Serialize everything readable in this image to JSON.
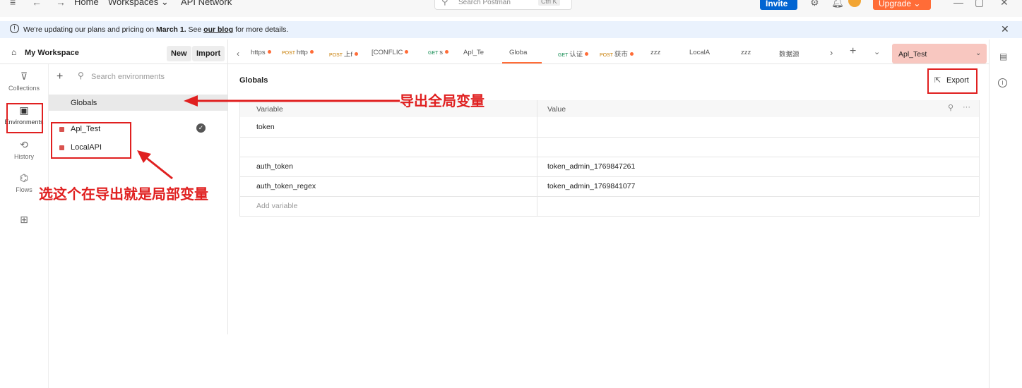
{
  "titlebar": {
    "nav": [
      "Home",
      "Workspaces",
      "API Network"
    ],
    "search_placeholder": "Search Postman",
    "search_shortcut": "Ctrl K",
    "invite_label": "Invite",
    "upgrade_label": "Upgrade"
  },
  "banner": {
    "text_before": "We're updating our plans and pricing on ",
    "date": "March 1.",
    "text_mid": " See ",
    "link": "our blog",
    "text_after": " for more details."
  },
  "workspace": {
    "title": "My Workspace",
    "new_label": "New",
    "import_label": "Import"
  },
  "rail": {
    "collections": "Collections",
    "environments": "Environments",
    "history": "History",
    "flows": "Flows"
  },
  "env_panel": {
    "search_placeholder": "Search environments",
    "globals_label": "Globals",
    "environments": [
      "Apl_Test",
      "LocalAPI"
    ]
  },
  "tabs": [
    {
      "method": "",
      "label": "https"
    },
    {
      "method": "POST",
      "label": "http"
    },
    {
      "method": "POST",
      "label": "上f"
    },
    {
      "method": "",
      "label": "[CONFLIC"
    },
    {
      "method": "GET",
      "label": "s"
    },
    {
      "method": "",
      "label": "Apl_Te"
    },
    {
      "method": "",
      "label": "Globa"
    },
    {
      "method": "GET",
      "label": "认证"
    },
    {
      "method": "POST",
      "label": "获市"
    },
    {
      "method": "",
      "label": "zzz"
    },
    {
      "method": "",
      "label": "LocalA"
    },
    {
      "method": "",
      "label": "zzz"
    },
    {
      "method": "",
      "label": "数据源"
    }
  ],
  "env_selector": "Apl_Test",
  "main": {
    "title": "Globals",
    "export_label": "Export",
    "col_variable": "Variable",
    "col_value": "Value",
    "rows": [
      {
        "variable": "token",
        "value": ""
      },
      {
        "variable": "",
        "value": ""
      },
      {
        "variable": "auth_token",
        "value": "token_admin_1769847261"
      },
      {
        "variable": "auth_token_regex",
        "value": "token_admin_1769841077"
      }
    ],
    "add_placeholder": "Add variable"
  },
  "annotations": {
    "export_globals": "导出全局变量",
    "select_local": "选这个在导出就是局部变量"
  },
  "colors": {
    "accent_orange": "#ff6c37",
    "invite_blue": "#0265d2",
    "annotation_red": "#e02020",
    "env_chip": "#f8c7c0"
  }
}
